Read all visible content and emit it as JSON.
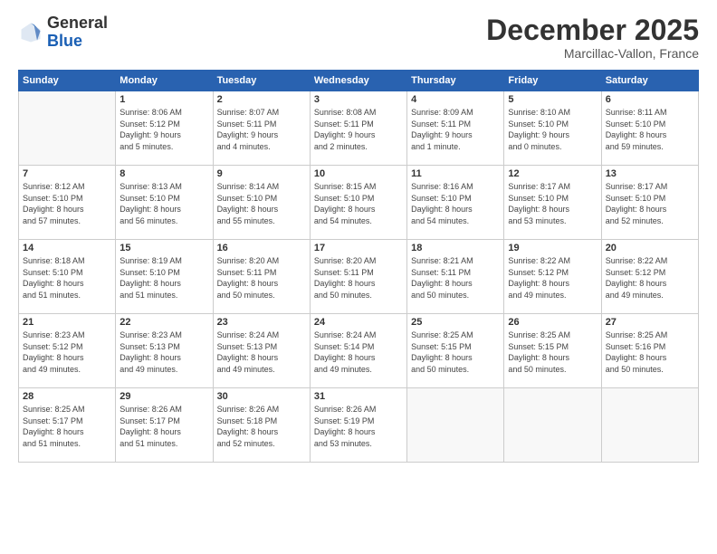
{
  "header": {
    "logo_general": "General",
    "logo_blue": "Blue",
    "month_title": "December 2025",
    "location": "Marcillac-Vallon, France"
  },
  "columns": [
    "Sunday",
    "Monday",
    "Tuesday",
    "Wednesday",
    "Thursday",
    "Friday",
    "Saturday"
  ],
  "weeks": [
    [
      {
        "day": "",
        "info": ""
      },
      {
        "day": "1",
        "info": "Sunrise: 8:06 AM\nSunset: 5:12 PM\nDaylight: 9 hours\nand 5 minutes."
      },
      {
        "day": "2",
        "info": "Sunrise: 8:07 AM\nSunset: 5:11 PM\nDaylight: 9 hours\nand 4 minutes."
      },
      {
        "day": "3",
        "info": "Sunrise: 8:08 AM\nSunset: 5:11 PM\nDaylight: 9 hours\nand 2 minutes."
      },
      {
        "day": "4",
        "info": "Sunrise: 8:09 AM\nSunset: 5:11 PM\nDaylight: 9 hours\nand 1 minute."
      },
      {
        "day": "5",
        "info": "Sunrise: 8:10 AM\nSunset: 5:10 PM\nDaylight: 9 hours\nand 0 minutes."
      },
      {
        "day": "6",
        "info": "Sunrise: 8:11 AM\nSunset: 5:10 PM\nDaylight: 8 hours\nand 59 minutes."
      }
    ],
    [
      {
        "day": "7",
        "info": "Sunrise: 8:12 AM\nSunset: 5:10 PM\nDaylight: 8 hours\nand 57 minutes."
      },
      {
        "day": "8",
        "info": "Sunrise: 8:13 AM\nSunset: 5:10 PM\nDaylight: 8 hours\nand 56 minutes."
      },
      {
        "day": "9",
        "info": "Sunrise: 8:14 AM\nSunset: 5:10 PM\nDaylight: 8 hours\nand 55 minutes."
      },
      {
        "day": "10",
        "info": "Sunrise: 8:15 AM\nSunset: 5:10 PM\nDaylight: 8 hours\nand 54 minutes."
      },
      {
        "day": "11",
        "info": "Sunrise: 8:16 AM\nSunset: 5:10 PM\nDaylight: 8 hours\nand 54 minutes."
      },
      {
        "day": "12",
        "info": "Sunrise: 8:17 AM\nSunset: 5:10 PM\nDaylight: 8 hours\nand 53 minutes."
      },
      {
        "day": "13",
        "info": "Sunrise: 8:17 AM\nSunset: 5:10 PM\nDaylight: 8 hours\nand 52 minutes."
      }
    ],
    [
      {
        "day": "14",
        "info": "Sunrise: 8:18 AM\nSunset: 5:10 PM\nDaylight: 8 hours\nand 51 minutes."
      },
      {
        "day": "15",
        "info": "Sunrise: 8:19 AM\nSunset: 5:10 PM\nDaylight: 8 hours\nand 51 minutes."
      },
      {
        "day": "16",
        "info": "Sunrise: 8:20 AM\nSunset: 5:11 PM\nDaylight: 8 hours\nand 50 minutes."
      },
      {
        "day": "17",
        "info": "Sunrise: 8:20 AM\nSunset: 5:11 PM\nDaylight: 8 hours\nand 50 minutes."
      },
      {
        "day": "18",
        "info": "Sunrise: 8:21 AM\nSunset: 5:11 PM\nDaylight: 8 hours\nand 50 minutes."
      },
      {
        "day": "19",
        "info": "Sunrise: 8:22 AM\nSunset: 5:12 PM\nDaylight: 8 hours\nand 49 minutes."
      },
      {
        "day": "20",
        "info": "Sunrise: 8:22 AM\nSunset: 5:12 PM\nDaylight: 8 hours\nand 49 minutes."
      }
    ],
    [
      {
        "day": "21",
        "info": "Sunrise: 8:23 AM\nSunset: 5:12 PM\nDaylight: 8 hours\nand 49 minutes."
      },
      {
        "day": "22",
        "info": "Sunrise: 8:23 AM\nSunset: 5:13 PM\nDaylight: 8 hours\nand 49 minutes."
      },
      {
        "day": "23",
        "info": "Sunrise: 8:24 AM\nSunset: 5:13 PM\nDaylight: 8 hours\nand 49 minutes."
      },
      {
        "day": "24",
        "info": "Sunrise: 8:24 AM\nSunset: 5:14 PM\nDaylight: 8 hours\nand 49 minutes."
      },
      {
        "day": "25",
        "info": "Sunrise: 8:25 AM\nSunset: 5:15 PM\nDaylight: 8 hours\nand 50 minutes."
      },
      {
        "day": "26",
        "info": "Sunrise: 8:25 AM\nSunset: 5:15 PM\nDaylight: 8 hours\nand 50 minutes."
      },
      {
        "day": "27",
        "info": "Sunrise: 8:25 AM\nSunset: 5:16 PM\nDaylight: 8 hours\nand 50 minutes."
      }
    ],
    [
      {
        "day": "28",
        "info": "Sunrise: 8:25 AM\nSunset: 5:17 PM\nDaylight: 8 hours\nand 51 minutes."
      },
      {
        "day": "29",
        "info": "Sunrise: 8:26 AM\nSunset: 5:17 PM\nDaylight: 8 hours\nand 51 minutes."
      },
      {
        "day": "30",
        "info": "Sunrise: 8:26 AM\nSunset: 5:18 PM\nDaylight: 8 hours\nand 52 minutes."
      },
      {
        "day": "31",
        "info": "Sunrise: 8:26 AM\nSunset: 5:19 PM\nDaylight: 8 hours\nand 53 minutes."
      },
      {
        "day": "",
        "info": ""
      },
      {
        "day": "",
        "info": ""
      },
      {
        "day": "",
        "info": ""
      }
    ]
  ]
}
